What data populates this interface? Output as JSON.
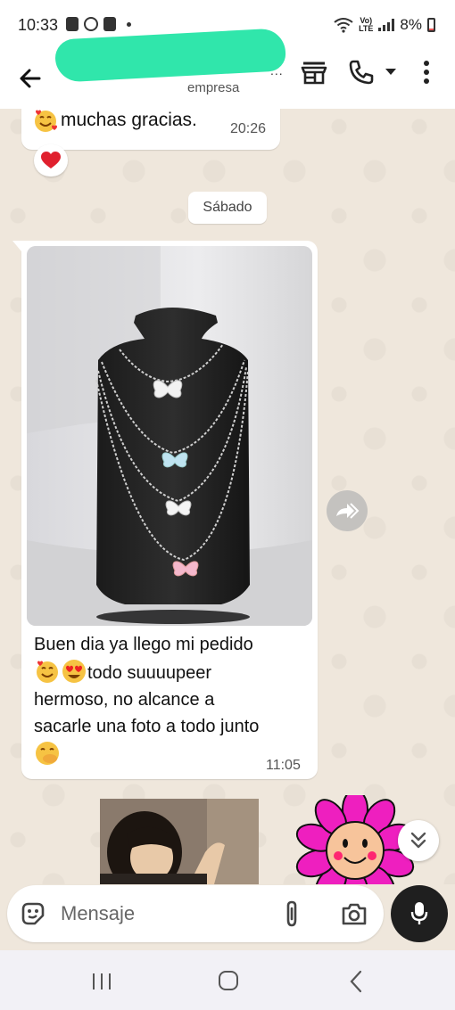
{
  "status_bar": {
    "time": "10:33",
    "battery": "8%",
    "network": "VoLTE"
  },
  "header": {
    "subtitle": "empresa",
    "overflow_dots": "..."
  },
  "messages": [
    {
      "text": "muchas gracias.",
      "time": "20:26",
      "reaction": "heart"
    },
    {
      "date_divider": "Sábado"
    },
    {
      "has_image": true,
      "caption_line1": "Buen dia ya llego mi pedido",
      "caption_line2": "todo suuuupeer",
      "caption_line3": "hermoso,  no alcance a",
      "caption_line4": "sacarle una foto a todo junto",
      "time": "11:05"
    }
  ],
  "input": {
    "placeholder": "Mensaje"
  },
  "colors": {
    "chat_bg": "#efe7dc",
    "bubble_bg": "#ffffff",
    "mic_bg": "#1f1f1f",
    "redaction": "#30e6ab"
  },
  "icons": [
    "back-arrow-icon",
    "store-icon",
    "phone-icon",
    "chevron-down-icon",
    "more-vert-icon",
    "forward-icon",
    "double-chevron-down-icon",
    "sticker-icon",
    "attach-icon",
    "camera-icon",
    "mic-icon",
    "recents-icon",
    "home-icon",
    "nav-back-icon"
  ]
}
